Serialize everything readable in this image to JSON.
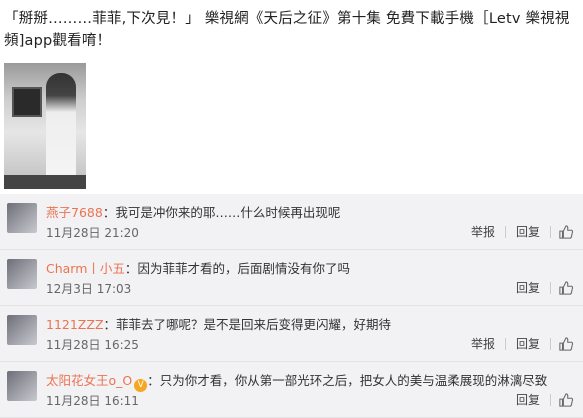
{
  "post": {
    "text": "「掰掰………菲菲,下次見！」 樂視網《天后之征》第十集 免費下載手機［Letv 樂視視頻]app觀看唷！"
  },
  "comments": [
    {
      "name": "燕子7688",
      "badge": "",
      "separator": "：",
      "text": "我可是冲你来的耶……什么时候再出现呢",
      "date": "11月28日 21:20",
      "actions": [
        "举报",
        "回复"
      ]
    },
    {
      "name": "Charm丨小五",
      "badge": "",
      "separator": "：",
      "text": "因为菲菲才看的，后面剧情没有你了吗",
      "date": "12月3日 17:03",
      "actions": [
        "回复"
      ]
    },
    {
      "name": "1121ZZZ",
      "badge": "",
      "separator": "：",
      "text": "菲菲去了哪呢？是不是回来后变得更闪耀，好期待",
      "date": "11月28日 16:25",
      "actions": [
        "举报",
        "回复"
      ]
    },
    {
      "name": "太阳花女王o_O",
      "badge": "V",
      "separator": "：",
      "text": "只为你才看，你从第一部光环之后，把女人的美与温柔展现的淋漓尽致",
      "date": "11月28日 16:11",
      "actions": [
        "回复"
      ]
    }
  ],
  "icons": {
    "like": "thumbs-up-icon"
  }
}
